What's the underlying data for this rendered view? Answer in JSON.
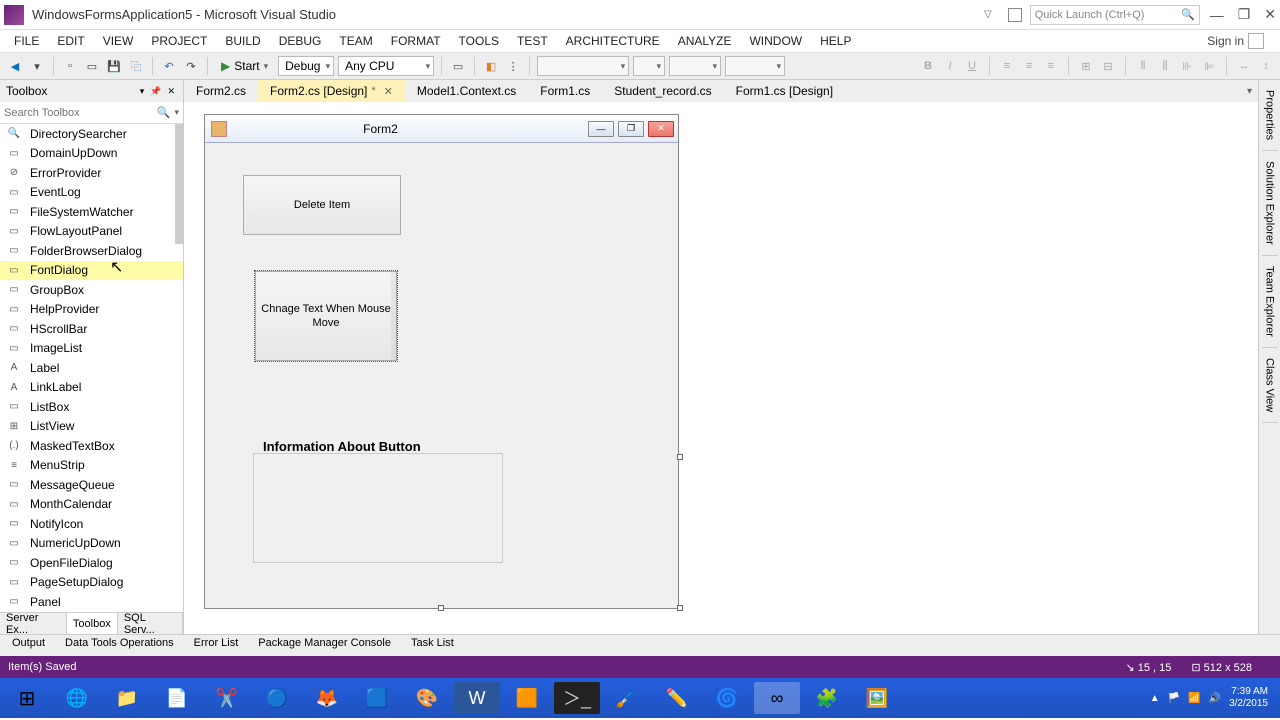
{
  "titlebar": {
    "title": "WindowsFormsApplication5 - Microsoft Visual Studio",
    "quick_launch_placeholder": "Quick Launch (Ctrl+Q)"
  },
  "menubar": {
    "items": [
      "FILE",
      "EDIT",
      "VIEW",
      "PROJECT",
      "BUILD",
      "DEBUG",
      "TEAM",
      "FORMAT",
      "TOOLS",
      "TEST",
      "ARCHITECTURE",
      "ANALYZE",
      "WINDOW",
      "HELP"
    ],
    "signin": "Sign in"
  },
  "toolbar": {
    "start": "Start",
    "config": "Debug",
    "platform": "Any CPU"
  },
  "toolbox": {
    "title": "Toolbox",
    "search_placeholder": "Search Toolbox",
    "items": [
      {
        "label": "DirectorySearcher",
        "icon": "🔍"
      },
      {
        "label": "DomainUpDown",
        "icon": "▭"
      },
      {
        "label": "ErrorProvider",
        "icon": "⊘"
      },
      {
        "label": "EventLog",
        "icon": "▭"
      },
      {
        "label": "FileSystemWatcher",
        "icon": "▭"
      },
      {
        "label": "FlowLayoutPanel",
        "icon": "▭"
      },
      {
        "label": "FolderBrowserDialog",
        "icon": "▭"
      },
      {
        "label": "FontDialog",
        "icon": "▭",
        "highlighted": true
      },
      {
        "label": "GroupBox",
        "icon": "▭"
      },
      {
        "label": "HelpProvider",
        "icon": "▭"
      },
      {
        "label": "HScrollBar",
        "icon": "▭"
      },
      {
        "label": "ImageList",
        "icon": "▭"
      },
      {
        "label": "Label",
        "icon": "A"
      },
      {
        "label": "LinkLabel",
        "icon": "A"
      },
      {
        "label": "ListBox",
        "icon": "▭"
      },
      {
        "label": "ListView",
        "icon": "⊞"
      },
      {
        "label": "MaskedTextBox",
        "icon": "(.)"
      },
      {
        "label": "MenuStrip",
        "icon": "≡"
      },
      {
        "label": "MessageQueue",
        "icon": "▭"
      },
      {
        "label": "MonthCalendar",
        "icon": "▭"
      },
      {
        "label": "NotifyIcon",
        "icon": "▭"
      },
      {
        "label": "NumericUpDown",
        "icon": "▭"
      },
      {
        "label": "OpenFileDialog",
        "icon": "▭"
      },
      {
        "label": "PageSetupDialog",
        "icon": "▭"
      },
      {
        "label": "Panel",
        "icon": "▭"
      }
    ],
    "tabs": [
      "Server Ex...",
      "Toolbox",
      "SQL Serv..."
    ]
  },
  "doc_tabs": [
    {
      "label": "Form2.cs"
    },
    {
      "label": "Form2.cs [Design]",
      "active": true,
      "dirty": true
    },
    {
      "label": "Model1.Context.cs"
    },
    {
      "label": "Form1.cs"
    },
    {
      "label": "Student_record.cs"
    },
    {
      "label": "Form1.cs [Design]"
    }
  ],
  "form": {
    "title": "Form2",
    "button1": "Delete Item",
    "button2": "Chnage Text When Mouse Move",
    "label1": "Information About Button"
  },
  "right_panels": [
    "Properties",
    "Solution Explorer",
    "Team Explorer",
    "Class View"
  ],
  "bottom_tabs": [
    "Output",
    "Data Tools Operations",
    "Error List",
    "Package Manager Console",
    "Task List"
  ],
  "statusbar": {
    "left": "Item(s) Saved",
    "pos": "15 , 15",
    "size": "512 x 528"
  },
  "taskbar": {
    "time": "7:39 AM",
    "date": "3/2/2015"
  }
}
